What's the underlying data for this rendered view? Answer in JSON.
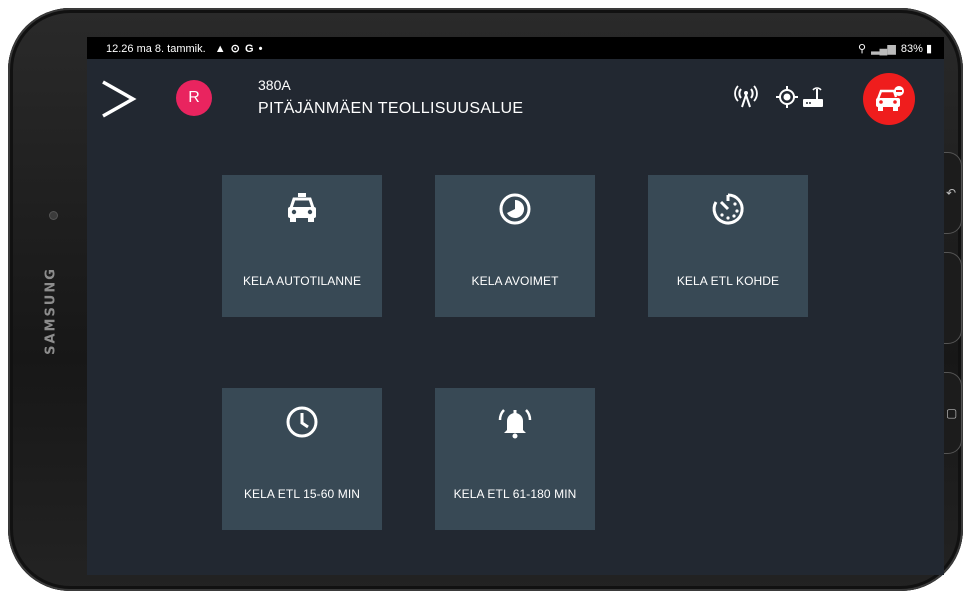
{
  "device": {
    "brand": "SAMSUNG"
  },
  "status_bar": {
    "time": "12.26",
    "date": "ma 8. tammik.",
    "left_icons": [
      "warning-icon",
      "sync-icon",
      "google-icon",
      "dot-icon"
    ],
    "left_icons_text": "▲ ⊙ G •",
    "battery": "83%"
  },
  "header": {
    "avatar_letter": "R",
    "vehicle_code": "380A",
    "location": "PITÄJÄNMÄEN TEOLLISUUSALUE",
    "icons": [
      "signal-tower-icon",
      "gps-target-icon",
      "router-icon"
    ],
    "fab_icon": "car-alert-icon",
    "fab_color": "#ef1d1d",
    "avatar_color": "#e9245f"
  },
  "tiles": [
    {
      "label": "KELA AUTOTILANNE",
      "icon": "taxi-icon"
    },
    {
      "label": "KELA AVOIMET",
      "icon": "pie-clock-icon"
    },
    {
      "label": "KELA ETL KOHDE",
      "icon": "timer-icon"
    },
    {
      "label": "KELA ETL 15-60 MIN",
      "icon": "clock-icon"
    },
    {
      "label": "KELA ETL 61-180 MIN",
      "icon": "bell-ring-icon"
    }
  ],
  "colors": {
    "screen_bg": "#222831",
    "tile_bg": "#384955"
  }
}
